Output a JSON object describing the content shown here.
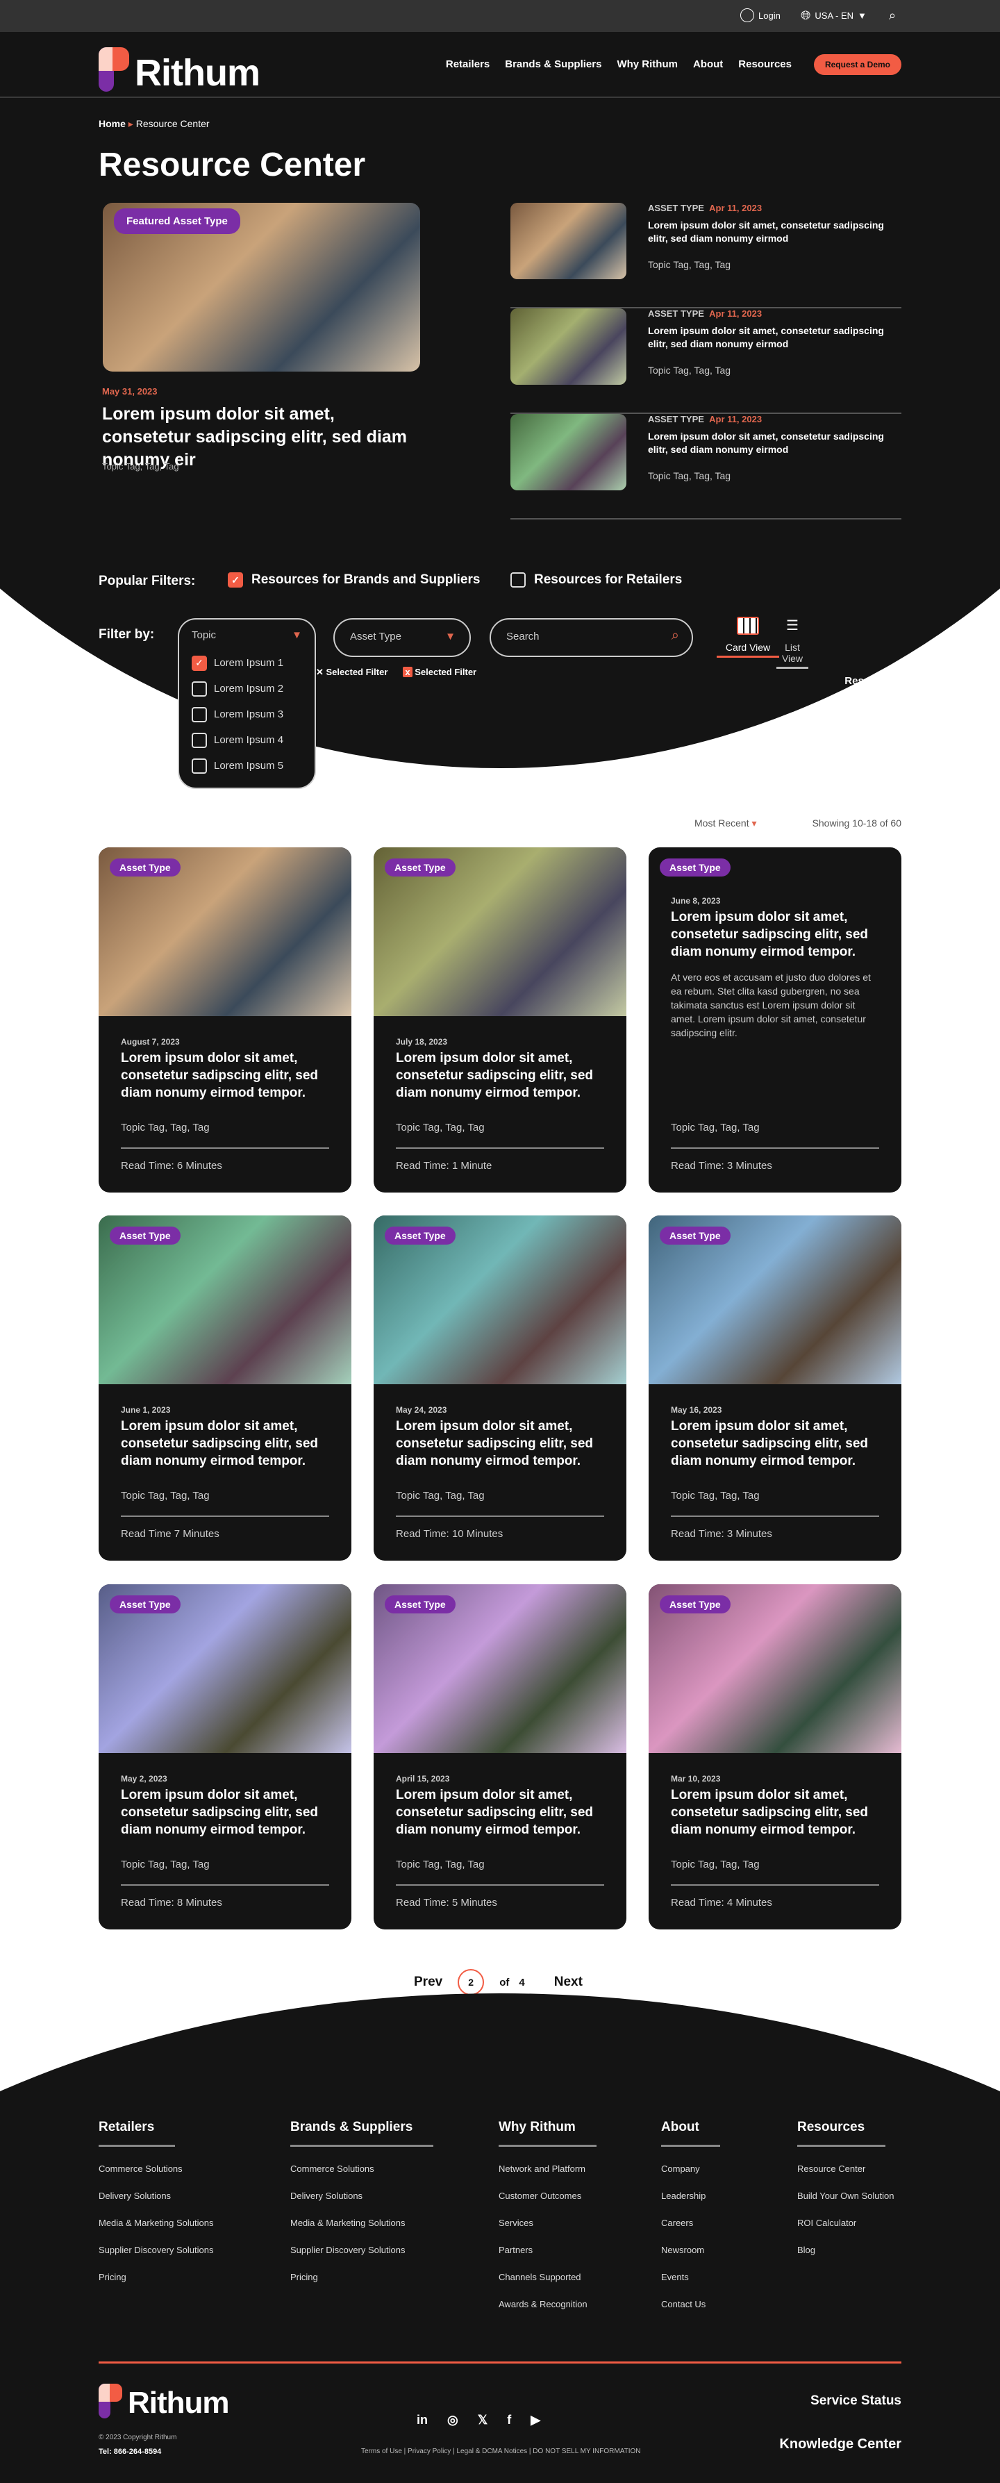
{
  "topbar": {
    "login": "Login",
    "locale": "USA - EN"
  },
  "nav": {
    "brand": "Rithum",
    "links": [
      "Retailers",
      "Brands & Suppliers",
      "Why Rithum",
      "About",
      "Resources"
    ],
    "cta": "Request a Demo"
  },
  "breadcrumb": {
    "home": "Home",
    "current": "Resource Center"
  },
  "page_title": "Resource Center",
  "featured": {
    "badge": "Featured Asset Type",
    "date": "May 31, 2023",
    "title": "Lorem ipsum dolor sit amet, consetetur sadipscing elitr, sed diam nonumy eir",
    "tags": "Topic Tag, Tag, Tag"
  },
  "side_items": [
    {
      "type": "ASSET TYPE",
      "date": "Apr 11, 2023",
      "title": "Lorem ipsum dolor sit amet, consetetur sadipscing elitr, sed diam nonumy eirmod",
      "tags": "Topic Tag, Tag, Tag"
    },
    {
      "type": "ASSET TYPE",
      "date": "Apr 11, 2023",
      "title": "Lorem ipsum dolor sit amet, consetetur sadipscing elitr, sed diam nonumy eirmod",
      "tags": "Topic Tag, Tag, Tag"
    },
    {
      "type": "ASSET TYPE",
      "date": "Apr 11, 2023",
      "title": "Lorem ipsum dolor sit amet, consetetur sadipscing elitr, sed diam nonumy eirmod",
      "tags": "Topic Tag, Tag, Tag"
    }
  ],
  "popular": {
    "label": "Popular Filters:",
    "options": [
      {
        "label": "Resources for Brands and Suppliers",
        "checked": true
      },
      {
        "label": "Resources for Retailers",
        "checked": false
      }
    ]
  },
  "filters": {
    "label": "Filter by:",
    "topic": "Topic",
    "topic_options": [
      {
        "label": "Lorem Ipsum 1",
        "checked": true
      },
      {
        "label": "Lorem Ipsum 2",
        "checked": false
      },
      {
        "label": "Lorem Ipsum 3",
        "checked": false
      },
      {
        "label": "Lorem Ipsum 4",
        "checked": false
      },
      {
        "label": "Lorem Ipsum 5",
        "checked": false
      }
    ],
    "asset_type": "Asset Type",
    "search_placeholder": "Search",
    "card_view": "Card View",
    "list_view": "List View",
    "selected": [
      "Selected Filter",
      "Selected Filter"
    ],
    "reset": "Reset Filter"
  },
  "sort": {
    "label": "Most Recent",
    "showing": "Showing 10-18 of 60"
  },
  "cards": [
    {
      "badge": "Asset Type",
      "date": "August 7, 2023",
      "title": "Lorem ipsum dolor sit amet, consetetur sadipscing elitr, sed diam nonumy eirmod tempor.",
      "tags": "Topic Tag, Tag, Tag",
      "read": "Read Time: 6 Minutes"
    },
    {
      "badge": "Asset Type",
      "date": "July 18, 2023",
      "title": "Lorem ipsum dolor sit amet, consetetur sadipscing elitr, sed diam nonumy eirmod tempor.",
      "tags": "Topic Tag, Tag, Tag",
      "read": "Read Time: 1 Minute"
    },
    {
      "badge": "Asset Type",
      "date": "June 8, 2023",
      "title": "Lorem ipsum dolor sit amet, consetetur sadipscing elitr, sed diam nonumy eirmod tempor.",
      "desc": "At vero eos et accusam et justo duo dolores et ea rebum. Stet clita kasd gubergren, no sea takimata sanctus est Lorem ipsum dolor sit amet. Lorem ipsum dolor sit amet, consetetur sadipscing elitr.",
      "tags": "Topic Tag, Tag, Tag",
      "read": "Read Time: 3 Minutes"
    },
    {
      "badge": "Asset Type",
      "date": "June 1, 2023",
      "title": "Lorem ipsum dolor sit amet, consetetur sadipscing elitr, sed diam nonumy eirmod tempor.",
      "tags": "Topic Tag, Tag, Tag",
      "read": "Read Time 7 Minutes"
    },
    {
      "badge": "Asset Type",
      "date": "May 24, 2023",
      "title": "Lorem ipsum dolor sit amet, consetetur sadipscing elitr, sed diam nonumy eirmod tempor.",
      "tags": "Topic Tag, Tag, Tag",
      "read": "Read Time: 10 Minutes"
    },
    {
      "badge": "Asset Type",
      "date": "May 16, 2023",
      "title": "Lorem ipsum dolor sit amet, consetetur sadipscing elitr, sed diam nonumy eirmod tempor.",
      "tags": "Topic Tag, Tag, Tag",
      "read": "Read Time: 3 Minutes"
    },
    {
      "badge": "Asset Type",
      "date": "May 2, 2023",
      "title": "Lorem ipsum dolor sit amet, consetetur sadipscing elitr, sed diam nonumy eirmod tempor.",
      "tags": "Topic Tag, Tag, Tag",
      "read": "Read Time: 8 Minutes"
    },
    {
      "badge": "Asset Type",
      "date": "April 15, 2023",
      "title": "Lorem ipsum dolor sit amet, consetetur sadipscing elitr, sed diam nonumy eirmod tempor.",
      "tags": "Topic Tag, Tag, Tag",
      "read": "Read Time: 5 Minutes"
    },
    {
      "badge": "Asset Type",
      "date": "Mar 10, 2023",
      "title": "Lorem ipsum dolor sit amet, consetetur sadipscing elitr, sed diam nonumy eirmod tempor.",
      "tags": "Topic Tag, Tag, Tag",
      "read": "Read Time: 4 Minutes"
    }
  ],
  "pagination": {
    "prev": "Prev",
    "current": "2",
    "of": "of",
    "total": "4",
    "next": "Next"
  },
  "footer": {
    "columns": [
      {
        "title": "Retailers",
        "links": [
          "Commerce Solutions",
          "Delivery Solutions",
          "Media & Marketing Solutions",
          "Supplier Discovery Solutions",
          "Pricing"
        ]
      },
      {
        "title": "Brands & Suppliers",
        "links": [
          "Commerce Solutions",
          "Delivery Solutions",
          "Media & Marketing Solutions",
          "Supplier Discovery Solutions",
          "Pricing"
        ]
      },
      {
        "title": "Why Rithum",
        "links": [
          "Network and Platform",
          "Customer Outcomes",
          "Services",
          "Partners",
          "Channels Supported",
          "Awards & Recognition"
        ]
      },
      {
        "title": "About",
        "links": [
          "Company",
          "Leadership",
          "Careers",
          "Newsroom",
          "Events",
          "Contact Us"
        ]
      },
      {
        "title": "Resources",
        "links": [
          "Resource Center",
          "Build Your Own Solution",
          "ROI Calculator",
          "Blog"
        ]
      }
    ],
    "brand": "Rithum",
    "copyright": "© 2023 Copyright Rithum",
    "tel": "Tel: 866-264-8594",
    "legal": "Terms of Use | Privacy Policy | Legal & DCMA Notices | DO NOT SELL MY INFORMATION",
    "social": [
      "linkedin-icon",
      "instagram-icon",
      "x-icon",
      "facebook-icon",
      "youtube-icon"
    ],
    "service_status": "Service Status",
    "knowledge_center": "Knowledge Center"
  },
  "colors": {
    "accent": "#f25c44",
    "badge": "#7b2ea6",
    "dark": "#141414"
  }
}
